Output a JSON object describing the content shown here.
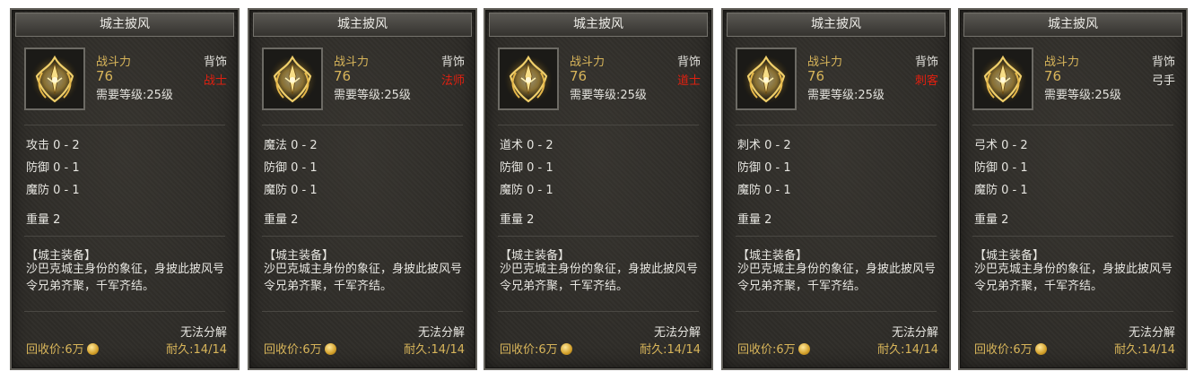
{
  "cards": [
    {
      "title": "城主披风",
      "power_label": "战斗力",
      "power": "76",
      "level_req": "需要等级:25级",
      "slot": "背饰",
      "class_name": "战士",
      "class_color": "#e02010",
      "stats": [
        "攻击 0 - 2",
        "防御 0 - 1",
        "魔防 0 - 1"
      ],
      "weight": "重量 2",
      "desc_title": "【城主装备】",
      "desc": "沙巴克城主身份的象征，身披此披风号令兄弟齐聚，千军齐结。",
      "no_dismantle": "无法分解",
      "recycle": "回收价:6万",
      "durability": "耐久:14/14"
    },
    {
      "title": "城主披风",
      "power_label": "战斗力",
      "power": "76",
      "level_req": "需要等级:25级",
      "slot": "背饰",
      "class_name": "法师",
      "class_color": "#e02010",
      "stats": [
        "魔法 0 - 2",
        "防御 0 - 1",
        "魔防 0 - 1"
      ],
      "weight": "重量 2",
      "desc_title": "【城主装备】",
      "desc": "沙巴克城主身份的象征，身披此披风号令兄弟齐聚，千军齐结。",
      "no_dismantle": "无法分解",
      "recycle": "回收价:6万",
      "durability": "耐久:14/14"
    },
    {
      "title": "城主披风",
      "power_label": "战斗力",
      "power": "76",
      "level_req": "需要等级:25级",
      "slot": "背饰",
      "class_name": "道士",
      "class_color": "#e02010",
      "stats": [
        "道术 0 - 2",
        "防御 0 - 1",
        "魔防 0 - 1"
      ],
      "weight": "重量 2",
      "desc_title": "【城主装备】",
      "desc": "沙巴克城主身份的象征，身披此披风号令兄弟齐聚，千军齐结。",
      "no_dismantle": "无法分解",
      "recycle": "回收价:6万",
      "durability": "耐久:14/14"
    },
    {
      "title": "城主披风",
      "power_label": "战斗力",
      "power": "76",
      "level_req": "需要等级:25级",
      "slot": "背饰",
      "class_name": "刺客",
      "class_color": "#e02010",
      "stats": [
        "刺术 0 - 2",
        "防御 0 - 1",
        "魔防 0 - 1"
      ],
      "weight": "重量 2",
      "desc_title": "【城主装备】",
      "desc": "沙巴克城主身份的象征，身披此披风号令兄弟齐聚，千军齐结。",
      "no_dismantle": "无法分解",
      "recycle": "回收价:6万",
      "durability": "耐久:14/14"
    },
    {
      "title": "城主披风",
      "power_label": "战斗力",
      "power": "76",
      "level_req": "需要等级:25级",
      "slot": "背饰",
      "class_name": "弓手",
      "class_color": "#e6e5e0",
      "stats": [
        "弓术 0 - 2",
        "防御 0 - 1",
        "魔防 0 - 1"
      ],
      "weight": "重量 2",
      "desc_title": "【城主装备】",
      "desc": "沙巴克城主身份的象征，身披此披风号令兄弟齐聚，千军齐结。",
      "no_dismantle": "无法分解",
      "recycle": "回收价:6万",
      "durability": "耐久:14/14"
    }
  ],
  "icon": "golden-cloak-emblem-icon"
}
